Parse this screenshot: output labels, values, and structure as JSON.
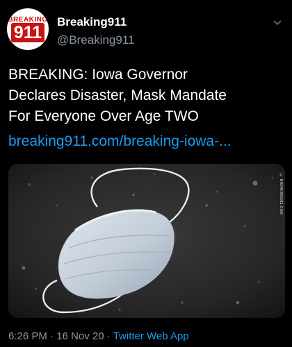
{
  "account": {
    "avatar_top_text": "BREAKING",
    "avatar_main_text": "911",
    "display_name": "Breaking911",
    "handle": "@Breaking911"
  },
  "tweet": {
    "text_lines": [
      "BREAKING: Iowa Governor",
      "Declares Disaster, Mask Mandate",
      "For Everyone Over Age TWO"
    ],
    "link_text": "breaking911.com/breaking-iowa-..."
  },
  "media": {
    "watermark_text": "© BREAKING911.COM"
  },
  "meta": {
    "time": "6:26 PM",
    "separator": "·",
    "date": "16 Nov 20",
    "source": "Twitter Web App"
  },
  "colors": {
    "background": "#000000",
    "link": "#1d9bf0",
    "muted": "#8b98a5",
    "brand_red": "#c81414"
  }
}
